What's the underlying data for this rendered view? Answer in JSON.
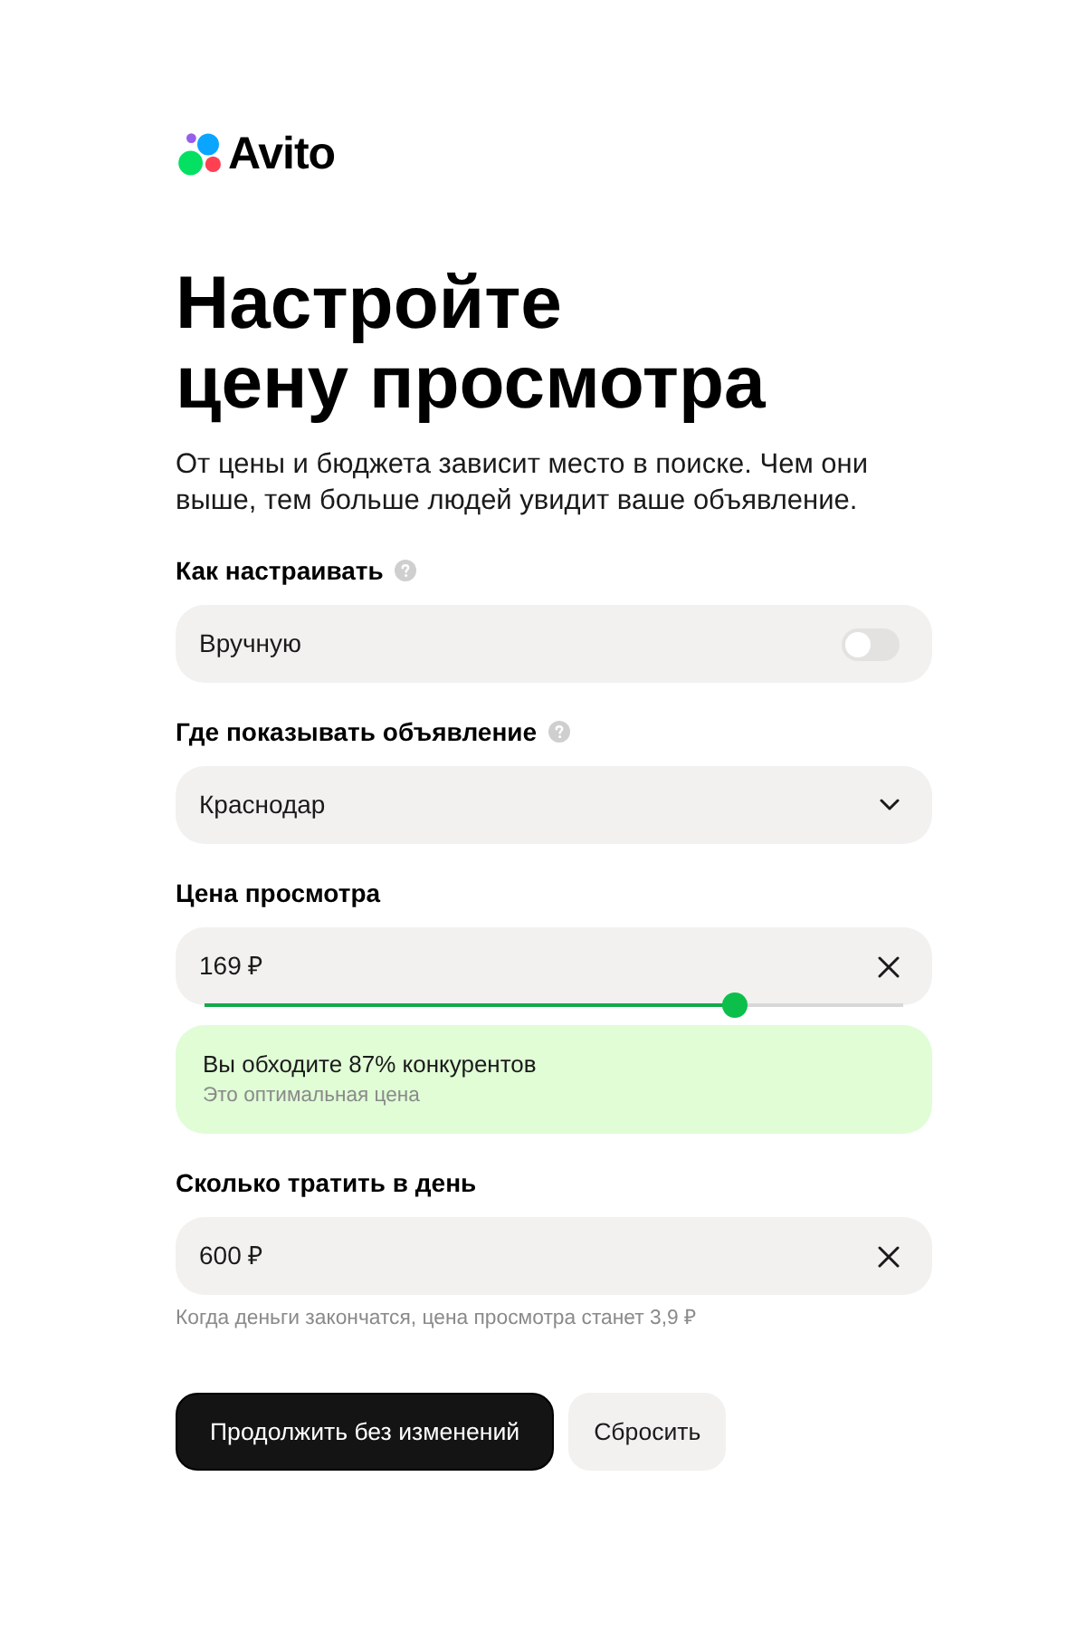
{
  "logo": {
    "text": "Avito"
  },
  "title_lines": [
    "Настройте",
    "цену просмотра"
  ],
  "description": "От цены и бюджета зависит место в поиске. Чем они выше, тем больше людей увидит ваше объявление.",
  "fields": [
    {
      "kind": "toggle",
      "label": "Как настраивать",
      "help": true,
      "value": "Вручную",
      "on": false
    },
    {
      "kind": "select",
      "label": "Где показывать объявление",
      "help": true,
      "value": "Краснодар"
    },
    {
      "kind": "slider",
      "label": "Цена просмотра",
      "value": "169 ₽",
      "level": 0.76,
      "note": {
        "title": "Вы обходите 87% конкурентов",
        "subtitle": "Это оптимальная цена"
      }
    },
    {
      "kind": "amount",
      "label": "Сколько тратить в день",
      "value": "600 ₽",
      "hint": "Когда деньги закончатся, цена просмотра станет 3,9 ₽"
    }
  ],
  "buttons": [
    {
      "kind": "primary",
      "label": "Продолжить без изменений"
    },
    {
      "kind": "secondary",
      "label": "Сбросить"
    }
  ]
}
